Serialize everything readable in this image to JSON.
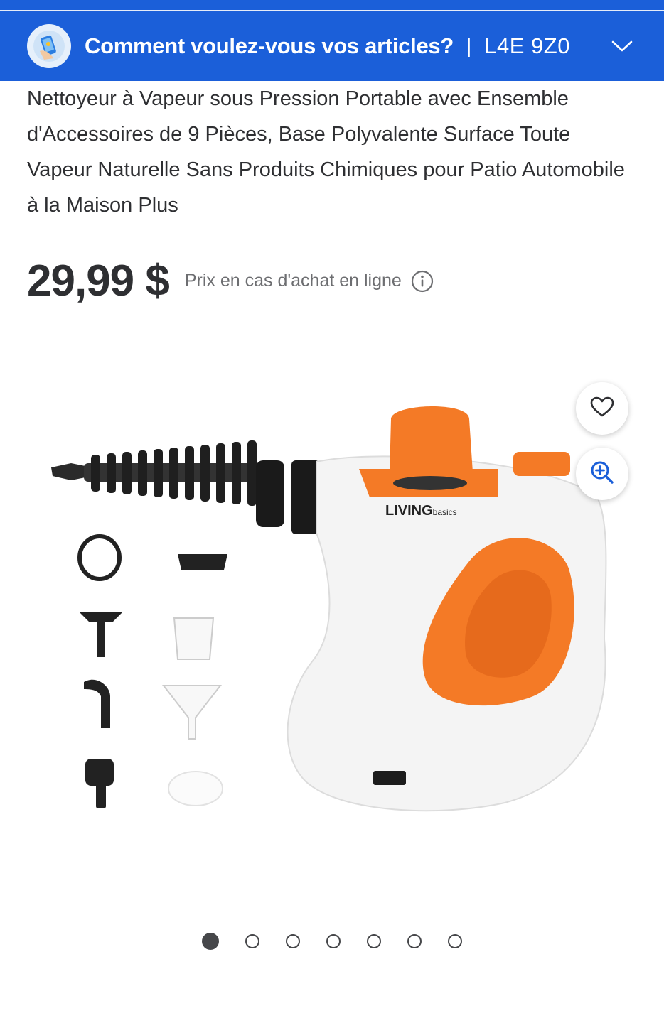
{
  "header": {
    "title": "Comment voulez-vous vos articles?",
    "separator": "|",
    "postal_code": "L4E 9Z0",
    "icon": "delivery-phone-icon",
    "chevron_icon": "chevron-down-icon",
    "background": "#1b5fd9"
  },
  "product": {
    "title": "Nettoyeur à Vapeur sous Pression Portable avec Ensemble d'Accessoires de 9 Pièces, Base Polyvalente Surface Toute Vapeur Naturelle Sans Produits Chimiques pour Patio Automobile à la Maison Plus",
    "price": "29,99 $",
    "price_note": "Prix en cas d'achat en ligne",
    "image_brand": "LIVING",
    "image_brand_sub": "basics",
    "accent_color": "#f47a26"
  },
  "actions": {
    "favorite_icon": "heart-icon",
    "zoom_icon": "zoom-in-icon"
  },
  "carousel": {
    "total": 7,
    "active_index": 0
  }
}
